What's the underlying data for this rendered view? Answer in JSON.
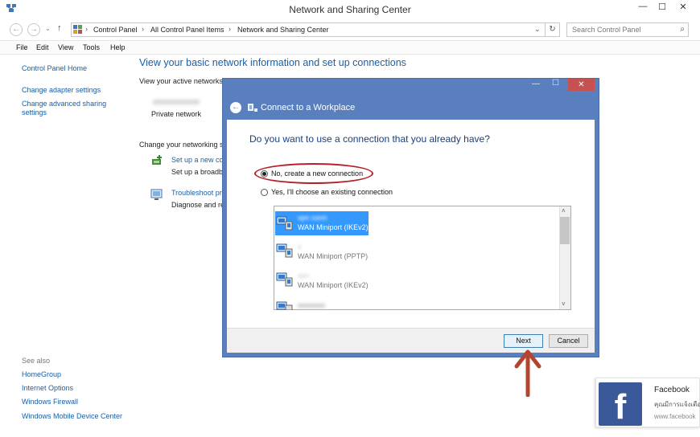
{
  "window": {
    "title": "Network and Sharing Center",
    "controls": {
      "minimize": "—",
      "maximize": "☐",
      "close": "✕"
    }
  },
  "address_bar": {
    "breadcrumbs": [
      "Control Panel",
      "All Control Panel Items",
      "Network and Sharing Center"
    ],
    "search_placeholder": "Search Control Panel"
  },
  "menu": [
    "File",
    "Edit",
    "View",
    "Tools",
    "Help"
  ],
  "left_pane": {
    "home": "Control Panel Home",
    "links": [
      "Change adapter settings",
      "Change advanced sharing settings"
    ],
    "see_also_label": "See also",
    "see_also": [
      "HomeGroup",
      "Internet Options",
      "Windows Firewall",
      "Windows Mobile Device Center"
    ]
  },
  "main": {
    "heading": "View your basic network information and set up connections",
    "active_networks_label": "View your active networks",
    "network_type": "Private network",
    "change_settings_label": "Change your networking s",
    "setup_link": "Set up a new co",
    "setup_desc": "Set up a broadb",
    "troubleshoot_link": "Troubleshoot pr",
    "troubleshoot_desc": "Diagnose and re"
  },
  "dialog": {
    "title": "Connect to a Workplace",
    "question": "Do you want to use a connection that you already have?",
    "option_new": "No, create a new connection",
    "option_existing": "Yes, I'll choose an existing connection",
    "connections": [
      {
        "name": "vpn conn",
        "type": "WAN Miniport (IKEv2)",
        "selected": true
      },
      {
        "name": "s",
        "type": "WAN Miniport (PPTP)",
        "selected": false
      },
      {
        "name": "vpn",
        "type": "WAN Miniport (IKEv2)",
        "selected": false
      },
      {
        "name": "",
        "type": "",
        "selected": false
      }
    ],
    "next_label": "Next",
    "cancel_label": "Cancel"
  },
  "facebook_widget": {
    "title": "Facebook",
    "subtitle": "คุณมีการแจ้งเตือ",
    "url": "www.facebook"
  },
  "colors": {
    "link": "#1a5ea7",
    "dialog_frame": "#5a7fbf",
    "selection": "#3399ff",
    "annotation": "#b3202a",
    "facebook": "#3b5998"
  }
}
